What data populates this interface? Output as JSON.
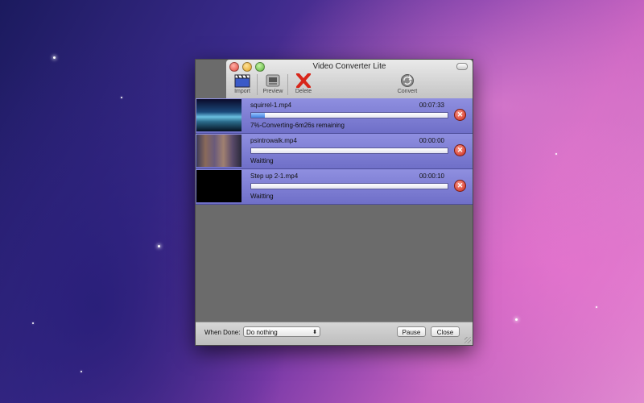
{
  "window": {
    "title": "Video Converter Lite"
  },
  "toolbar": {
    "import_label": "Import",
    "preview_label": "Preview",
    "delete_label": "Delete",
    "convert_label": "Convert"
  },
  "jobs": [
    {
      "file": "squirrel-1.mp4",
      "duration": "00:07:33",
      "status": "7%-Converting-6m26s remaining",
      "progress": 0.07
    },
    {
      "file": "psintrowalk.mp4",
      "duration": "00:00:00",
      "status": "Waitting",
      "progress": 0
    },
    {
      "file": "Step up 2-1.mp4",
      "duration": "00:00:10",
      "status": "Waitting",
      "progress": 0
    }
  ],
  "bottom": {
    "when_done_label": "When Done:",
    "when_done_value": "Do nothing",
    "pause_label": "Pause",
    "close_label": "Close"
  },
  "colors": {
    "row_bg": "#7f7fd6",
    "progress_fill": "#3f7fe0",
    "delete_icon": "#c8261a"
  }
}
